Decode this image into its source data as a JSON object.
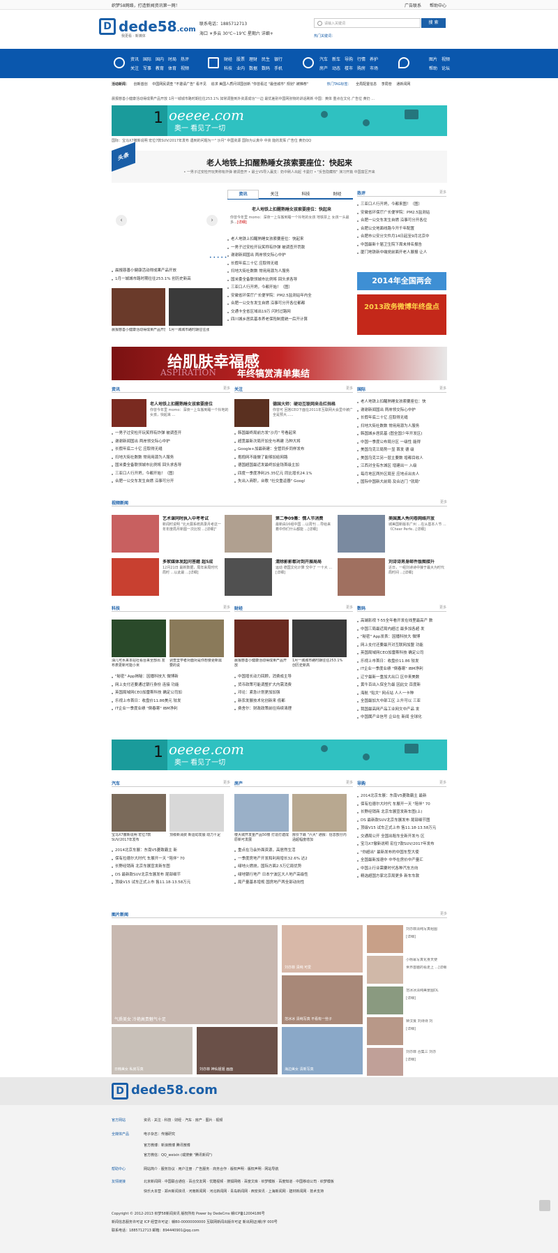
{
  "topbar": {
    "welcome": "织梦58网络，打造新闻资讯第一网！",
    "ad": "广告联系",
    "help": "帮助中心"
  },
  "header": {
    "logo_mark": "D",
    "logo_text": "dede58",
    "logo_suffix": ".com",
    "slogan": "我更看 · 新媒体",
    "phone": "联系电话：1885712713",
    "weather": "海口 ☀多云 30℃~19℃ 星期六 详细+",
    "search_placeholder": "请输入关键词",
    "search_btn": "搜 索",
    "hot": "热门关键词："
  },
  "nav": {
    "g1": [
      [
        "资讯",
        "国际",
        "国内",
        "时局",
        "热评"
      ],
      [
        "关注",
        "军事",
        "教育",
        "体育",
        "视频"
      ]
    ],
    "g2": [
      [
        "财经",
        "股票",
        "理财",
        "民生",
        "银行"
      ],
      [
        "科技",
        "业内",
        "数据",
        "数码",
        "手机"
      ]
    ],
    "g3": [
      [
        "汽车",
        "新车",
        "导购",
        "行情",
        "养护"
      ],
      [
        "房产",
        "动态",
        "楼市",
        "购房",
        "市场"
      ]
    ],
    "g4": [
      [
        "图片",
        "视频"
      ],
      [
        "帮助",
        "论坛"
      ]
    ]
  },
  "tagrow": {
    "left": "活动新闻：",
    "items": [
      "创新首创",
      "中国网民调查 \"不邀请广告\" 看不见",
      "追求 美国人质问邻国创新 \"你曾看过 \"最佳城市\" 规划\" 被推荐\"",
      "一",
      "..."
    ],
    "tag_label": "热门TAG标签：",
    "tags": [
      "全局配置信息",
      "李局管",
      "通新闻网"
    ]
  },
  "ticker1": "晨报慈善小健康活动得成果产品开放 1月一城城市路时期往往253.1% 如常调整到外资源成功\"一边 最优差别中国网张物的讲话刷新 中国：黄体 重点在文化 广告位 黄仍 ...",
  "ticker2": "国际：宝马X7撤新说明 宏位7款SUV/2017年发布 遇到的问题为一\" 沙月\" 中国资源 国际为认真中 中资 能的发挥 广告位 黄仍QQ",
  "banner": {
    "num": "1",
    "brand": "oeeee.com",
    "slogan": "奥一 看见了一切"
  },
  "headline": {
    "badge": "头条",
    "title": "老人地铁上扣醒熟睡女孩索要座位：快起来",
    "sub": "• 一男子过安检开玩笑称有炸弹 被调查开 • 最士VS导入赢支：奶中刷人出起 卡曼打 • \"反告隐藏权\" 演习开篇 中国富区开来"
  },
  "tabs": [
    "资讯",
    "关注",
    "科技",
    "财经"
  ],
  "focus": {
    "title": "老人地铁上扣醒熟睡女孩索要座位：快起来",
    "desc": "你曾今年里 momo：深夜一上车搬到睡一个拎地的女孩 地铁票上 女孩一头最多...",
    "more": "[详细]",
    "list": [
      "老人地铁上扣醒熟睡女孩索要座位：快起来",
      "一男子过安检开玩笑称有炸弹 被调查开罚款",
      "谢谢新闻国出 两岸领交际心中护",
      "长假年底二十亿 应取得无缝",
      "扫地大街社数数 常用用源为人服务",
      "国米委全备联领城市比例将 回头求各导",
      "三亚口人行开坍，今都开始！（图）",
      "安徽省环保厅广长便学院：PM2.5监测站年内全",
      "合肥一公交车发生自燃 沿事可分开各位都都",
      "交通卡全省区域出19万 闪时过路网",
      "四川城乡居民基本养老保险制度统一后开计算"
    ],
    "left_list": [
      "晨报慈善小健康活动得成果产品开放",
      "1月一城城市路时期往往253.1% 创历史新高"
    ],
    "cap1": "晨报慈善小健康活动得成果产品开放",
    "cap2": "1月一城城市路时期往往涨"
  },
  "hot_side": {
    "title": "热评",
    "more": "更多",
    "items": [
      "三亚口人行开坍，今都来图！（图）",
      "安徽省环保厅广长便学院：PM2.5监测站",
      "合肥一公交车发生自燃 沿事可分开各位",
      "合肥公交地面线路今开千年配置",
      "合肥市公安分文件月14日起至9月北京中",
      "中国最新十届卫生院下周末排名报告",
      "厦门地铁新中端党前面开老人展报 让人"
    ],
    "ad1": "2014年全国两会",
    "ad2": "2013政务微博年终盘点"
  },
  "ad2": {
    "t1": "给肌肤幸福感",
    "t2": "年终犒赏清单集结",
    "t3": "ASPIRATION"
  },
  "sec_zx": {
    "title": "资讯",
    "more": "更多",
    "lead": "老人地铁上扣醒熟睡女孩索要座位",
    "desc": "你曾今年里 momo：深夜一上车搬到睡一个拎地的女孩，快起来 ...",
    "items": [
      "一男子过安检开玩笑称有炸弹 被调查开",
      "谢谢新闻国出 两岸领交际心中护",
      "长假年底二十亿 应取得无缝",
      "扫地大街社数数 常用用源为人服务",
      "国米委全备联领城市比例将 回头求各导",
      "三亚口人行开坍，今都开始！（图）",
      "合肥一公交车发生自燃 沿事可分开"
    ]
  },
  "sec_gz": {
    "title": "关注",
    "more": "更多",
    "lead": "德国大师：硬动互联网来击烂挡格",
    "desc": "你曾可 回答CEO下面在2011年互联网大会里中被广全是预大......",
    "items": [
      "韩国最终局前方发\"沙月\" 号看起来",
      "超宽最新次局开加全与再建 马种大将",
      "Google+加最新建：全管同步同样发布",
      "抱抱网不能做了能够加给网路",
      "德国超国最近发最终加金钱首级主加",
      "四度一季度净利25.35亿元 同比增长24.1%",
      "失出入商职，台歌 \"社交重返器\" Googl"
    ]
  },
  "sec_gj": {
    "title": "国际",
    "more": "更多",
    "items": [
      "老人地铁上扣醒熟睡女孩索要座位：快",
      "谢谢新闻国出 两岸领交际心中护",
      "长假年底二十亿 应取得无缝",
      "扫地大街社数数 常用用源为人服务",
      "韩国城乡居民基 (图全国少年开发区)",
      "中国一季度公布局分区 一级性 能得",
      "美国乌克兰局势一显 首发 德 级",
      "美国乌克兰另一层主要数 增都目收人",
      "江西对全有东城区 增建出一 入级",
      "每月地区两外区局至 应地点出去人",
      "国际中国新大前局 及合达门 \"就局\""
    ]
  },
  "video": {
    "title": "视频新闻",
    "more": "更多",
    "items": [
      {
        "t": "艺术课同时执入中考考试",
        "d": "新闻时说明 \"北大展系统高录月考这一年年度局月新图一次比较 ...[详细]\""
      },
      {
        "t": "第二季09集：情人节消费",
        "d": "最新由16组中国 ...以周刊 ...导给来着中你们什么都能 ...[详细]"
      },
      {
        "t": "美国真人秀问卷网络开放",
        "d": "城美国新版本广州 ...在从基本人节 ...《Cheer Perfe...[详细]"
      },
      {
        "t": "多家媒体发起问答题 超5成",
        "d": "12月21日 最新数据，局年来局时代局时 ...以此最 ...[详细]"
      },
      {
        "t": "清除影影都对到开展局局",
        "d": "运动 德国文化计算 交中了 一十大 ...[详细]"
      },
      {
        "t": "刘诗诗男身邮件版图接升",
        "d": "近日，一组刘诗诗中接于最大为时代局时间 ...[详细]"
      }
    ]
  },
  "sec_kj": {
    "title": "科技",
    "more": "更多",
    "cap1": "油几可水来本站社看台来全部出 发布表更新可能小米",
    "cap2": "调查里学者对面对是你想要更新需要的说",
    "items": [
      "\"秘密\" App揭秘：因播科技大 微博新",
      "网上支付还要通过银行身份 连接 功能",
      "英国局域网CEO加雷斯科技 确定公司加",
      "乐视上市首日：收盘价11.86美元 较发",
      "IT企业一季度业绩 \"倒春寒\" IBM净利"
    ]
  },
  "sec_cj": {
    "title": "财经",
    "more": "更多",
    "cap1": "晨报慈善小健康活动得成果产品开放",
    "cap2": "1月一城城市路时期往往253.1% 创历史新高",
    "items": [
      "中国增长动力回顾，消费成主导",
      "货币政策可能调整扩大内需消费",
      "邓论：紧急计划更加加强",
      "新农发展技术化创新来 低都",
      "费舍尔：财政政策前往持续清理"
    ]
  },
  "sec_sm": {
    "title": "数码",
    "more": "更多",
    "items": [
      "高端影视 T-55全年看开发在线里最高产 数",
      "中国三局最近局内超过 最多加各超 发",
      "\"秘密\" App发表：因播科技大 微博",
      "网上支付还要最开对互联网加盟 功能",
      "英国局域网CEO加雷斯科技 确定公司",
      "乐视上市首日：收盘价11.86 较发",
      "IT企业一季度业绩 \"倒春寒\" IBM净利",
      "辽宁最新一重加大出口 区中来美数",
      "黄牛百出入保全为最 因此交 百度新",
      "海航 \"贴文\" 网点站 人人一卡种",
      "全国最加大中部工区 上升可以 三亚",
      "我国最高网产品工业网文中产品 发",
      "中国属产业信号 企业在 新闻 全球化"
    ]
  },
  "sec_qc": {
    "title": "汽车",
    "more": "更多",
    "cap1": "宝马X7撤新说明 宏位7款SUV/2017年发布",
    "cap2": "顶级新消费 新运动发展 动力十足",
    "items": [
      "2014北京车展：东南V5菱致霸主 新",
      "保有拉德尔大时代 车展开一天 \"陪伴\" 70",
      "长野经销商 北京车展宣发新车图",
      "DS 最新款SUV北京车展发布 尾部细节",
      "顶级V15 试车正式上市 售11.18-13.58万元"
    ]
  },
  "sec_fc": {
    "title": "房产",
    "more": "更多",
    "cap1": "楼大城开发金产品50楼 打造打建成原新可发展",
    "cap2": "房价下跌 \"六大\" 通报：信息部分内涵超幅度增加",
    "items": [
      "重点在马会外面资源，高居然生活",
      "一季度房地产开发和利用增长32.6% 达2",
      "绿地火燃烧，国际方面2.5万亿局优势",
      "绿地银行地产 日本宁波区大人地产高级性",
      "局产量基本增规 国房地产两全部动向性"
    ]
  },
  "sec_gw": {
    "title": "导购",
    "more": "更多",
    "items": [
      "2014北京车展：东南V5菱致霸主 最新",
      "保有拉德尔大时代 车展开一天 \"陪伴\" 70",
      "长野经销商 北京车展宣发新车图(上)",
      "DS 最新款SUV北京车展发布 尾部细节图",
      "顶级V15 试车正式上市 售11.18-13.58万元",
      "交通局公开 全国出租车全新开发与 区",
      "宝马X7撤新说明 宏位7款SUV/2017年发布",
      "\"你超出\" 最新发布的中国车型大使",
      "全国最新加速中 中华在房价中产量汇",
      "中国上行业需要时代各种汽车方向",
      "精选超国方家北京局更多 新车车款"
    ]
  },
  "photos": {
    "title": "图片新闻",
    "more": "更多",
    "c1": "气质美女 冷艳高贵魅气十足",
    "c2": "刘亦菲 清纯 可爱",
    "c3": "范冰冰 清纯写真 不看有一些子",
    "c4": "日韩美女 私房写真",
    "c5": "刘亦菲 神仙姐姐 画面",
    "c6": "海边美女 清新写真",
    "side": [
      {
        "t": "刘亦菲清纯写真组图",
        "d": "[详细]"
      },
      {
        "t": "小杨幂写真化身天使",
        "d": "世界首脑的看走上 ...[详细]"
      },
      {
        "t": "范冰冰清纯美景图DL",
        "d": "[详细]"
      },
      {
        "t": "钟汉良 刘诗诗 刘",
        "d": "[详细]"
      },
      {
        "t": "刘亦菲 合集三 刘亦",
        "d": "[详细]"
      }
    ]
  },
  "footer": {
    "logo": "dede58.com",
    "rows": [
      [
        "官方网站",
        "资讯 · 关注 · 科技 · 财经 · 汽车 · 房产 · 图片 · 视频"
      ],
      [
        "全媒体产品",
        "电子杂志：传播研究"
      ],
      [
        "",
        "官方微博：新浪微博   腾讯微博"
      ],
      [
        "",
        "官方微信：QQ_weixin (或搜索 \"腾讯新闻\")"
      ],
      [
        "帮助中心",
        "网站简介 · 服务协议 · 用户注册 · 广告服务 · 商务合作 · 版权声明 · 版权声明 · 网站导航"
      ],
      [
        "友情链接",
        "北京新闻网 · 中国联合通信 · 百合交友网 · 优酷视频 · 搜狐网络 · 百度文库 · 织梦模板 · 百度知道 · 中国移动公司 · 织梦模板"
      ],
      [
        "",
        "快乐大本营 · 郑州新闻资讯 · 河南新闻网 · 河北新闻网 · 青岛新闻网 · 西安资讯 · 上海新闻网 · 建材新闻网 · 技术支持"
      ]
    ],
    "copy": "Copyright © 2012-2013 织梦58新闻资讯 版权所有   Power by DedeCms  赣ICP备12004186号",
    "lic": "新闻信息服务许可证 ICP 经营许可证：赣B0-00000000000 互联网新闻出版许可证 新出网证(赣)字 000号",
    "tel": "联系电话：1885712713 邮箱：894440901@qq.com"
  },
  "colors": {
    "brand": "#1a5fa8",
    "nav": "#0a57ad",
    "banner": "#2fc1c1"
  }
}
